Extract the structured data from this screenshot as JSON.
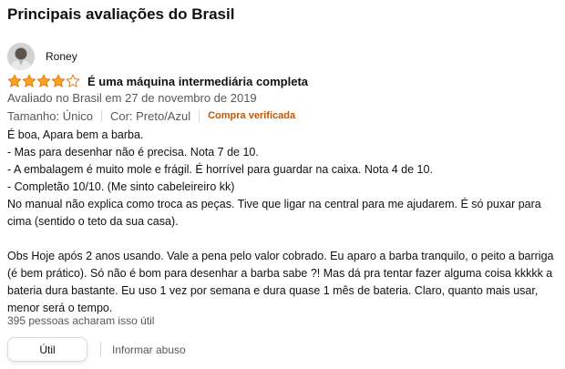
{
  "section": {
    "title": "Principais avaliações do Brasil"
  },
  "review": {
    "author": "Roney",
    "rating": 4,
    "rating_max": 5,
    "title": "É uma máquina intermediária completa",
    "date": "Avaliado no Brasil em 27 de novembro de 2019",
    "size": "Tamanho: Único",
    "color": "Cor: Preto/Azul",
    "verified": "Compra verificada",
    "body_lines": [
      "É boa, Apara bem a barba.",
      "- Mas para desenhar não é precisa. Nota 7 de 10.",
      "- A embalagem é muito mole e frágil. É horrível para guardar na caixa. Nota 4 de 10.",
      "- Completão 10/10. (Me sinto cabeleireiro kk)",
      "No manual não explica como troca as peças. Tive que ligar na central para me ajudarem. É só puxar para cima (sentido o teto da sua casa)."
    ],
    "body_after": "Obs Hoje após 2 anos usando. Vale a pena pelo valor cobrado. Eu aparo a barba tranquilo, o peito a barriga (é bem prático). Só não é bom para desenhar a barba sabe ?! Mas dá pra tentar fazer alguma coisa kkkkk a bateria dura bastante. Eu uso 1 vez por semana e dura quase 1 mês de bateria. Claro, quanto mais usar, menor será o tempo.",
    "helpful_count": "395 pessoas acharam isso útil"
  },
  "actions": {
    "useful_label": "Útil",
    "report_label": "Informar abuso"
  },
  "colors": {
    "star_fill": "#ffa41c",
    "star_outline": "#de7921",
    "verified": "#c45500",
    "muted_text": "#565959",
    "text": "#0f1111"
  },
  "icons": {
    "avatar": "user-avatar-icon",
    "star": "star-icon"
  }
}
